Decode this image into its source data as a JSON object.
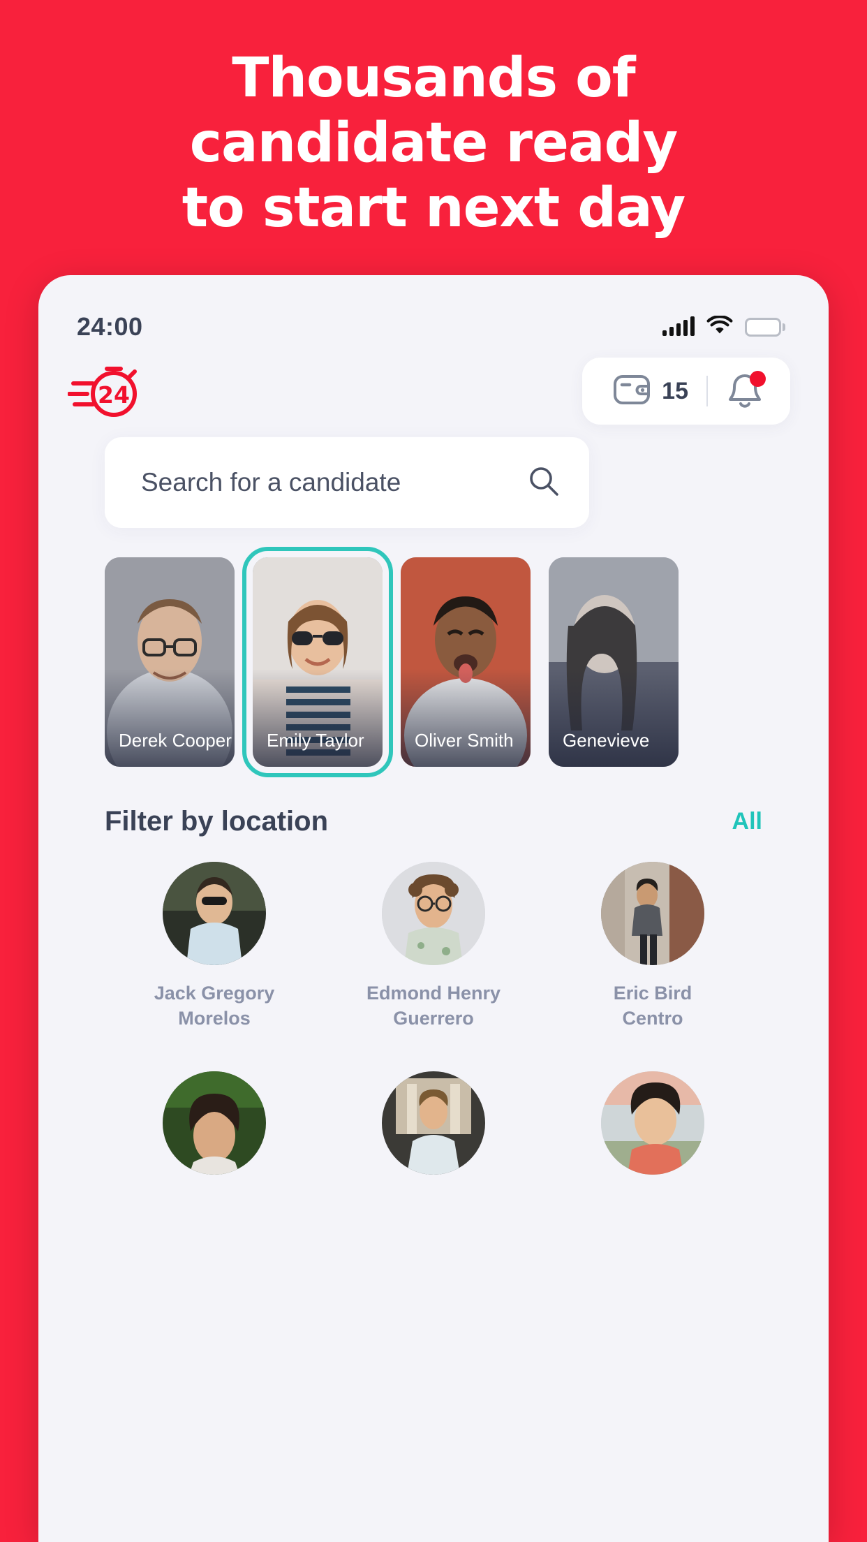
{
  "brand": {
    "accent_red": "#F8213C",
    "accent_teal": "#20C4BA",
    "logo_name": "stopwatch-24-logo",
    "logo_text": "24"
  },
  "headline": {
    "line1": "Thousands of",
    "line2": "candidate ready",
    "line3": "to start next day"
  },
  "statusbar": {
    "time": "24:00",
    "signal_icon": "cellular-signal-icon",
    "wifi_icon": "wifi-icon",
    "battery_icon": "battery-full-icon"
  },
  "header": {
    "wallet_icon": "wallet-icon",
    "wallet_count": "15",
    "bell_icon": "notification-bell-icon",
    "bell_has_badge": true
  },
  "search": {
    "placeholder": "Search for a candidate",
    "value": "",
    "icon": "search-icon"
  },
  "carousel": {
    "cards": [
      {
        "name": "Derek Cooper",
        "selected": false
      },
      {
        "name": "Emily Taylor",
        "selected": true
      },
      {
        "name": "Oliver Smith",
        "selected": false
      },
      {
        "name": "Genevieve",
        "selected": false
      }
    ]
  },
  "filter": {
    "title": "Filter by location",
    "all_label": "All"
  },
  "locations": {
    "items": [
      {
        "name": "Jack Gregory",
        "place": "Morelos"
      },
      {
        "name": "Edmond Henry",
        "place": "Guerrero"
      },
      {
        "name": "Eric Bird",
        "place": "Centro"
      },
      {
        "name": "",
        "place": ""
      },
      {
        "name": "",
        "place": ""
      },
      {
        "name": "",
        "place": ""
      }
    ]
  }
}
